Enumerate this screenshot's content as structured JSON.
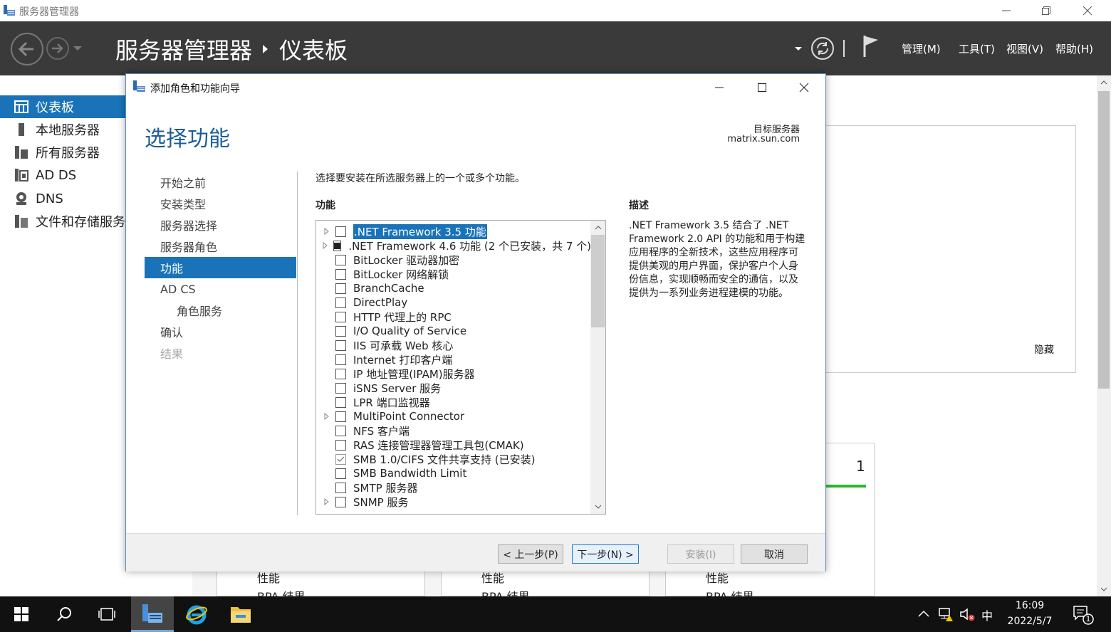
{
  "window": {
    "title": "服务器管理器"
  },
  "header": {
    "breadcrumb_app": "服务器管理器",
    "breadcrumb_page": "仪表板",
    "menu": [
      "管理(M)",
      "工具(T)",
      "视图(V)",
      "帮助(H)"
    ]
  },
  "nav": {
    "items": [
      "仪表板",
      "本地服务器",
      "所有服务器",
      "AD DS",
      "DNS",
      "文件和存储服务"
    ],
    "selected": "仪表板"
  },
  "background": {
    "hide_label": "隐藏",
    "tile_count": "1",
    "tile_labels": [
      "性能",
      "性能",
      "性能"
    ],
    "tile_sub": [
      "BPA 结果",
      "BPA 结果",
      "BPA 结果"
    ]
  },
  "dialog": {
    "title": "添加角色和功能向导",
    "page_title": "选择功能",
    "target_label": "目标服务器",
    "target_value": "matrix.sun.com",
    "steps": [
      "开始之前",
      "安装类型",
      "服务器选择",
      "服务器角色",
      "功能",
      "AD CS",
      "角色服务",
      "确认",
      "结果"
    ],
    "selected_step": "功能",
    "instruction": "选择要安装在所选服务器上的一个或多个功能。",
    "features_heading": "功能",
    "description_heading": "描述",
    "description": ".NET Framework 3.5 结合了 .NET Framework 2.0 API 的功能和用于构建应用程序的全新技术，这些应用程序可提供美观的用户界面，保护客户个人身份信息，实现顺畅而安全的通信，以及提供为一系列业务进程建模的功能。",
    "features": [
      {
        "label": ".NET Framework 3.5 功能",
        "expandable": true,
        "state": "unchecked",
        "highlighted": true
      },
      {
        "label": ".NET Framework 4.6 功能 (2 个已安装，共 7 个)",
        "expandable": true,
        "state": "partial"
      },
      {
        "label": "BitLocker 驱动器加密",
        "expandable": false,
        "state": "unchecked"
      },
      {
        "label": "BitLocker 网络解锁",
        "expandable": false,
        "state": "unchecked"
      },
      {
        "label": "BranchCache",
        "expandable": false,
        "state": "unchecked"
      },
      {
        "label": "DirectPlay",
        "expandable": false,
        "state": "unchecked"
      },
      {
        "label": "HTTP 代理上的 RPC",
        "expandable": false,
        "state": "unchecked"
      },
      {
        "label": "I/O Quality of Service",
        "expandable": false,
        "state": "unchecked"
      },
      {
        "label": "IIS 可承载 Web 核心",
        "expandable": false,
        "state": "unchecked"
      },
      {
        "label": "Internet 打印客户端",
        "expandable": false,
        "state": "unchecked"
      },
      {
        "label": "IP 地址管理(IPAM)服务器",
        "expandable": false,
        "state": "unchecked"
      },
      {
        "label": "iSNS Server 服务",
        "expandable": false,
        "state": "unchecked"
      },
      {
        "label": "LPR 端口监视器",
        "expandable": false,
        "state": "unchecked"
      },
      {
        "label": "MultiPoint Connector",
        "expandable": true,
        "state": "unchecked"
      },
      {
        "label": "NFS 客户端",
        "expandable": false,
        "state": "unchecked"
      },
      {
        "label": "RAS 连接管理器管理工具包(CMAK)",
        "expandable": false,
        "state": "unchecked"
      },
      {
        "label": "SMB 1.0/CIFS 文件共享支持 (已安装)",
        "expandable": false,
        "state": "installed"
      },
      {
        "label": "SMB Bandwidth Limit",
        "expandable": false,
        "state": "unchecked"
      },
      {
        "label": "SMTP 服务器",
        "expandable": false,
        "state": "unchecked"
      },
      {
        "label": "SNMP 服务",
        "expandable": true,
        "state": "unchecked"
      }
    ],
    "buttons": {
      "prev": "< 上一步(P)",
      "next": "下一步(N) >",
      "install": "安装(I)",
      "cancel": "取消"
    }
  },
  "taskbar": {
    "ime": "中",
    "time": "16:09",
    "date": "2022/5/7",
    "notification_count": "1"
  },
  "colors": {
    "accent": "#1a73b9",
    "header_bg": "#3a3a3a",
    "title_blue": "#1c5d99"
  }
}
